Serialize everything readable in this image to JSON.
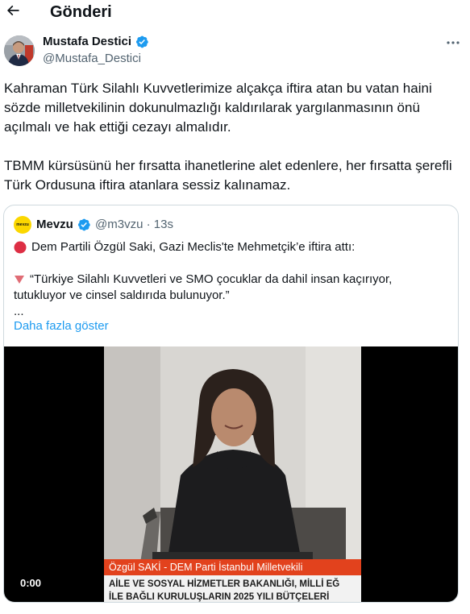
{
  "header": {
    "title": "Gönderi",
    "back_icon": "arrow-left-icon"
  },
  "author": {
    "name": "Mustafa Destici",
    "handle": "@Mustafa_Destici",
    "verified": true,
    "verified_color": "#1d9bf0"
  },
  "more_icon": "ellipsis-icon",
  "tweet": {
    "paragraphs": [
      "Kahraman Türk Silahlı Kuvvetlerimize alçakça iftira atan bu vatan haini sözde milletvekilinin dokunulmazlığı kaldırılarak yargılanmasının önü açılmalı ve hak ettiği cezayı almalıdır.",
      "TBMM kürsüsünü her fırsatta ihanetlerine alet edenlere, her fırsatta şerefli Türk Ordusuna iftira atanlara sessiz kalınamaz."
    ]
  },
  "quote": {
    "avatar_text": "mevzu",
    "name": "Mevzu",
    "verified": true,
    "handle": "@m3vzu",
    "separator": "·",
    "time": "13s",
    "line1": "Dem Partili Özgül Saki, Gazi Meclis'te Mehmetçik’e iftira attı:",
    "line2": "“Türkiye Silahlı Kuvvetleri ve SMO çocuklar da dahil insan kaçırıyor,",
    "line3": "tutukluyor ve cinsel saldırıda bulunuyor.”",
    "line4": "...",
    "show_more": "Daha fazla göster",
    "video": {
      "lower_third_name": "Özgül SAKİ - DEM Parti İstanbul Milletvekili",
      "caption_line1": "AİLE VE SOSYAL HİZMETLER BAKANLIĞI, MİLLİ EĞ",
      "caption_line2": "İLE BAĞLI KURULUŞLARIN 2025 YILI BÜTÇELERİ",
      "timestamp": "0:00"
    }
  },
  "colors": {
    "link": "#1d9bf0",
    "secondary_text": "#536471",
    "border": "#cfd9de",
    "lower_third_bg": "#e2421d",
    "red_circle": "#dd2e44",
    "brand_yellow": "#fbd700"
  }
}
